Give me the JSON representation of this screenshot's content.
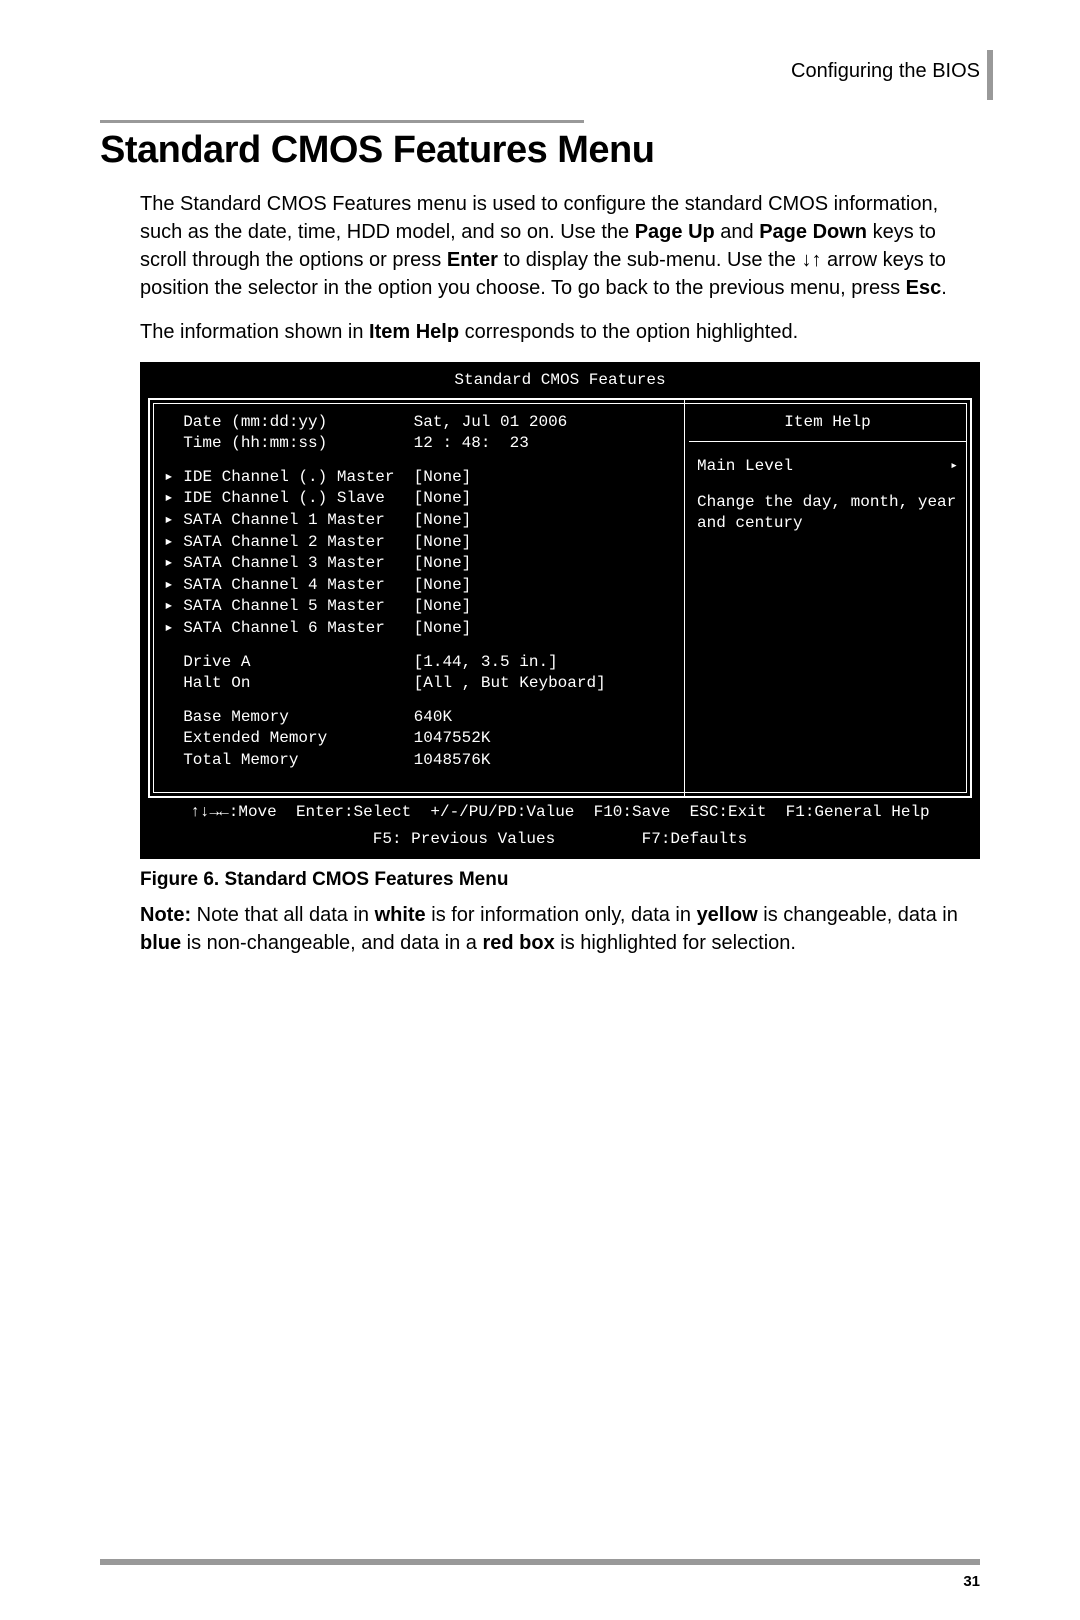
{
  "header": {
    "section": "Configuring the BIOS"
  },
  "title": "Standard CMOS Features Menu",
  "para1_parts": [
    "The Standard CMOS Features menu is used to configure the standard CMOS information, such as the date, time, HDD model, and so on. Use the ",
    "Page Up",
    " and ",
    "Page Down",
    " keys to scroll through the options or press ",
    "Enter",
    " to display the sub-menu. Use the ↓↑ arrow keys to position the selector in the option you choose. To go back to the previous menu, press ",
    "Esc",
    "."
  ],
  "para2_parts": [
    "The information shown in ",
    "Item Help",
    " corresponds to the option highlighted."
  ],
  "bios": {
    "title": "Standard CMOS Features",
    "datetime": [
      {
        "label": "Date (mm:dd:yy)",
        "value": "Sat, Jul 01 2006"
      },
      {
        "label": "Time (hh:mm:ss)",
        "value": "12 : 48:  23"
      }
    ],
    "channels": [
      {
        "label": "IDE Channel (.) Master",
        "value": "[None]"
      },
      {
        "label": "IDE Channel (.) Slave",
        "value": "[None]"
      },
      {
        "label": "SATA Channel 1 Master",
        "value": "[None]"
      },
      {
        "label": "SATA Channel 2 Master",
        "value": "[None]"
      },
      {
        "label": "SATA Channel 3 Master",
        "value": "[None]"
      },
      {
        "label": "SATA Channel 4 Master",
        "value": "[None]"
      },
      {
        "label": "SATA Channel 5 Master",
        "value": "[None]"
      },
      {
        "label": "SATA Channel 6 Master",
        "value": "[None]"
      }
    ],
    "drives": [
      {
        "label": "Drive A",
        "value": "[1.44, 3.5 in.]"
      },
      {
        "label": "Halt On",
        "value": "[All , But Keyboard]"
      }
    ],
    "memory": [
      {
        "label": "Base Memory",
        "value": "640K"
      },
      {
        "label": "Extended Memory",
        "value": "1047552K"
      },
      {
        "label": "Total Memory",
        "value": "1048576K"
      }
    ],
    "help": {
      "header": "Item Help",
      "level": "Main Level",
      "text": "Change the day, month, year and century"
    },
    "footer1": "↑↓→←:Move  Enter:Select  +/-/PU/PD:Value  F10:Save  ESC:Exit  F1:General Help",
    "footer2": "F5: Previous Values         F7:Defaults"
  },
  "caption": "Figure 6. Standard CMOS Features Menu",
  "note_parts": [
    "Note:",
    " Note that all data in ",
    "white",
    " is for information only, data in ",
    "yellow",
    " is changeable, data in ",
    "blue",
    " is non-changeable, and data in a ",
    "red box",
    " is highlighted for selection."
  ],
  "page_number": "31"
}
